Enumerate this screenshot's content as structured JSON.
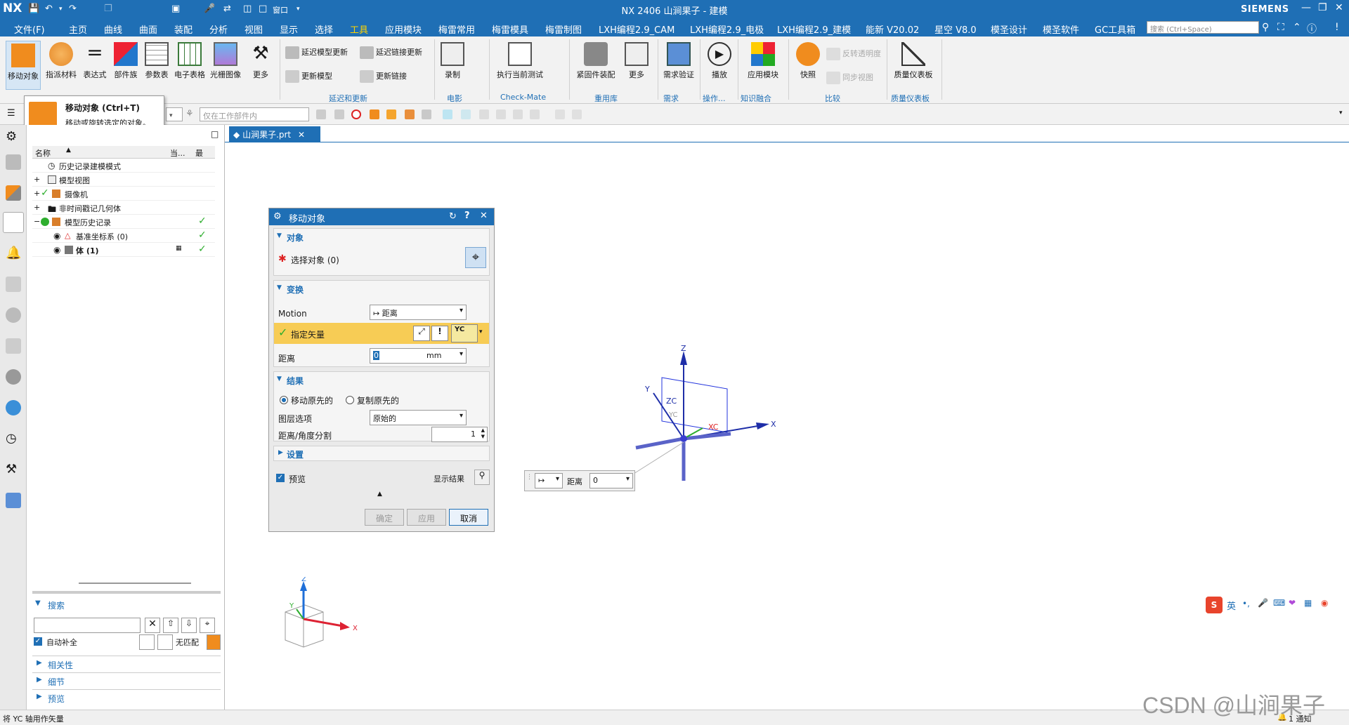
{
  "titlebar": {
    "logo": "NX",
    "title": "NX 2406 山涧果子 - 建模",
    "brand": "SIEMENS",
    "window_menu": "窗口"
  },
  "menu": {
    "items": [
      "文件(F)",
      "主页",
      "曲线",
      "曲面",
      "装配",
      "分析",
      "视图",
      "显示",
      "选择",
      "工具",
      "应用模块",
      "梅雷常用",
      "梅雷模具",
      "梅雷制图",
      "LXH编程2.9_CAM",
      "LXH编程2.9_电极",
      "LXH编程2.9_建模",
      "能新 V20.02",
      "星空 V8.0",
      "模圣设计",
      "模圣软件",
      "GC工具箱"
    ],
    "active_index": 9,
    "search_placeholder": "搜索 (Ctrl+Space)"
  },
  "ribbon": {
    "big_buttons": [
      "移动对象",
      "指派材料",
      "表达式",
      "部件族",
      "参数表",
      "电子表格",
      "光栅图像",
      "更多"
    ],
    "delay_group": {
      "items": [
        "延迟模型更新",
        "延迟链接更新",
        "更新模型",
        "更新链接"
      ],
      "label": "延迟和更新"
    },
    "movie_group": {
      "button": "录制",
      "label": "电影"
    },
    "checkmate_group": {
      "button": "执行当前测试",
      "label": "Check-Mate"
    },
    "reuse_group": {
      "buttons": [
        "紧固件装配",
        "更多"
      ],
      "label": "重用库"
    },
    "req_group": {
      "button": "需求验证",
      "label": "需求"
    },
    "op_group": {
      "button": "播放",
      "label": "操作..."
    },
    "knowledge_group": {
      "button": "应用模块",
      "label": "知识融合"
    },
    "compare_group": {
      "buttons": [
        "快照",
        "反转透明度",
        "同步视图"
      ],
      "label": "比较"
    },
    "dashboard_group": {
      "button": "质量仪表板",
      "label": "质量仪表板"
    }
  },
  "toolbar2": {
    "filter_placeholder": "仅在工作部件内"
  },
  "tooltip": {
    "title": "移动对象 (Ctrl+T)",
    "desc": "移动或旋转选定的对象。"
  },
  "navigator": {
    "headers": {
      "name": "名称",
      "current": "当...",
      "latest": "最"
    },
    "rows": [
      {
        "label": "历史记录建模模式"
      },
      {
        "label": "模型视图"
      },
      {
        "label": "摄像机"
      },
      {
        "label": "非时间戳记几何体"
      },
      {
        "label": "模型历史记录"
      },
      {
        "label": "基准坐标系 (0)"
      },
      {
        "label": "体 (1)"
      }
    ],
    "search": {
      "title": "搜索",
      "autocomplete": "自动补全",
      "no_match": "无匹配"
    },
    "panels": [
      "相关性",
      "细节",
      "预览"
    ]
  },
  "graphics": {
    "tab_label": "山涧果子.prt",
    "axis_labels": {
      "x": "X",
      "y": "Y",
      "z": "Z",
      "xc": "XC",
      "yc": "YC",
      "zc": "ZC"
    }
  },
  "dialog": {
    "title": "移动对象",
    "object_section": "对象",
    "select_object": "选择对象 (0)",
    "transform_section": "变换",
    "motion_label": "Motion",
    "motion_value": "距离",
    "vector_label": "指定矢量",
    "vector_value": "YC",
    "distance_label": "距离",
    "distance_value": "0",
    "distance_unit": "mm",
    "result_section": "结果",
    "move_original": "移动原先的",
    "copy_original": "复制原先的",
    "layer_label": "图层选项",
    "layer_value": "原始的",
    "divide_label": "距离/角度分割",
    "divide_value": "1",
    "settings_section": "设置",
    "preview_label": "预览",
    "show_result": "显示结果",
    "ok": "确定",
    "apply": "应用",
    "cancel": "取消"
  },
  "floating_input": {
    "label": "距离",
    "value": "0"
  },
  "status": {
    "text": "将 YC 轴用作矢量",
    "notify": "1 通知"
  },
  "watermark": "CSDN @山涧果子",
  "ime": {
    "lang": "英"
  },
  "colors": {
    "accent": "#1f6fb5",
    "highlight": "#f7cc55",
    "check": "#2eae2e",
    "orange": "#f08c1e"
  }
}
